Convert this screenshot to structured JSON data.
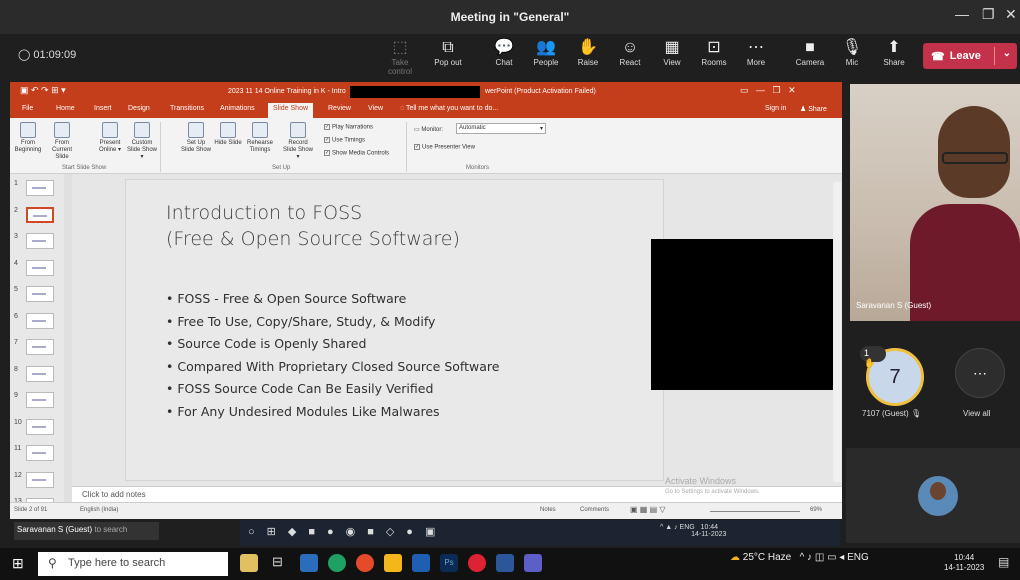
{
  "window": {
    "title": "Meeting in \"General\"",
    "min": "—",
    "max": "❐",
    "close": "✕"
  },
  "meeting": {
    "timer": "01:09:09",
    "buttons": [
      {
        "label": "Take control",
        "icon": "⬚"
      },
      {
        "label": "Pop out",
        "icon": "⧉"
      },
      {
        "label": "Chat",
        "icon": "💬"
      },
      {
        "label": "People",
        "icon": "👥"
      },
      {
        "label": "Raise",
        "icon": "✋"
      },
      {
        "label": "React",
        "icon": "☺"
      },
      {
        "label": "View",
        "icon": "▦"
      },
      {
        "label": "Rooms",
        "icon": "⊡"
      },
      {
        "label": "More",
        "icon": "⋯"
      },
      {
        "label": "Camera",
        "icon": "■"
      },
      {
        "label": "Mic",
        "icon": "🎙"
      },
      {
        "label": "Share",
        "icon": "⬆"
      }
    ],
    "people_badge": "",
    "leave_label": "Leave",
    "leave_icon": "☎"
  },
  "ppt": {
    "title": "2023 11 14 Online Training in K - Intro",
    "title_right": "werPoint (Product Activation Failed)",
    "tabs": [
      "File",
      "Home",
      "Insert",
      "Design",
      "Transitions",
      "Animations",
      "Slide Show",
      "Review",
      "View"
    ],
    "tell_me": "Tell me what you want to do...",
    "sign_in": "Sign in",
    "share": "Share",
    "ribbon": {
      "buttons": [
        {
          "label": "From Beginning"
        },
        {
          "label": "From Current Slide"
        },
        {
          "label": "Present Online ▾"
        },
        {
          "label": "Custom Slide Show ▾"
        },
        {
          "label": "Set Up Slide Show"
        },
        {
          "label": "Hide Slide"
        },
        {
          "label": "Rehearse Timings"
        },
        {
          "label": "Record Slide Show ▾"
        }
      ],
      "checks": [
        "Play Narrations",
        "Use Timings",
        "Show Media Controls"
      ],
      "monitor_label": "Monitor:",
      "monitor_value": "Automatic",
      "presenter_view": "Use Presenter View",
      "groups": [
        "Start Slide Show",
        "Set Up",
        "Monitors"
      ]
    },
    "thumbs": [
      "1",
      "2",
      "3",
      "4",
      "5",
      "6",
      "7",
      "8",
      "9",
      "10",
      "11",
      "12",
      "13"
    ],
    "slide": {
      "title1": "Introduction to FOSS",
      "title2": "(Free & Open Source Software)",
      "bullets": [
        "FOSS - Free & Open Source Software",
        "Free To Use, Copy/Share, Study, & Modify",
        "Source Code is Openly Shared",
        "Compared With Proprietary Closed Source Software",
        "FOSS Source Code Can Be Easily Verified",
        "For Any Undesired Modules Like Malwares"
      ]
    },
    "notes_placeholder": "Click to add notes",
    "status": {
      "slide": "Slide 2 of 91",
      "lang": "English (India)",
      "notes": "Notes",
      "comments": "Comments",
      "zoom": "69%"
    },
    "activate": {
      "title": "Activate Windows",
      "sub": "Go to Settings to activate Windows."
    }
  },
  "participants": {
    "video_name": "Saravanan S (Guest)",
    "hand_count": "1",
    "avatar_number": "7",
    "avatar_name": "7107 (Guest)",
    "view_all": "View all",
    "more_icon": "⋯"
  },
  "shared_taskbar": {
    "presenter": "Saravanan S (Guest)",
    "search": "to search"
  },
  "taskbar": {
    "search": "Type here to search",
    "weather": "25°C Haze",
    "lang": "ENG",
    "time": "10:44",
    "date": "14-11-2023"
  }
}
